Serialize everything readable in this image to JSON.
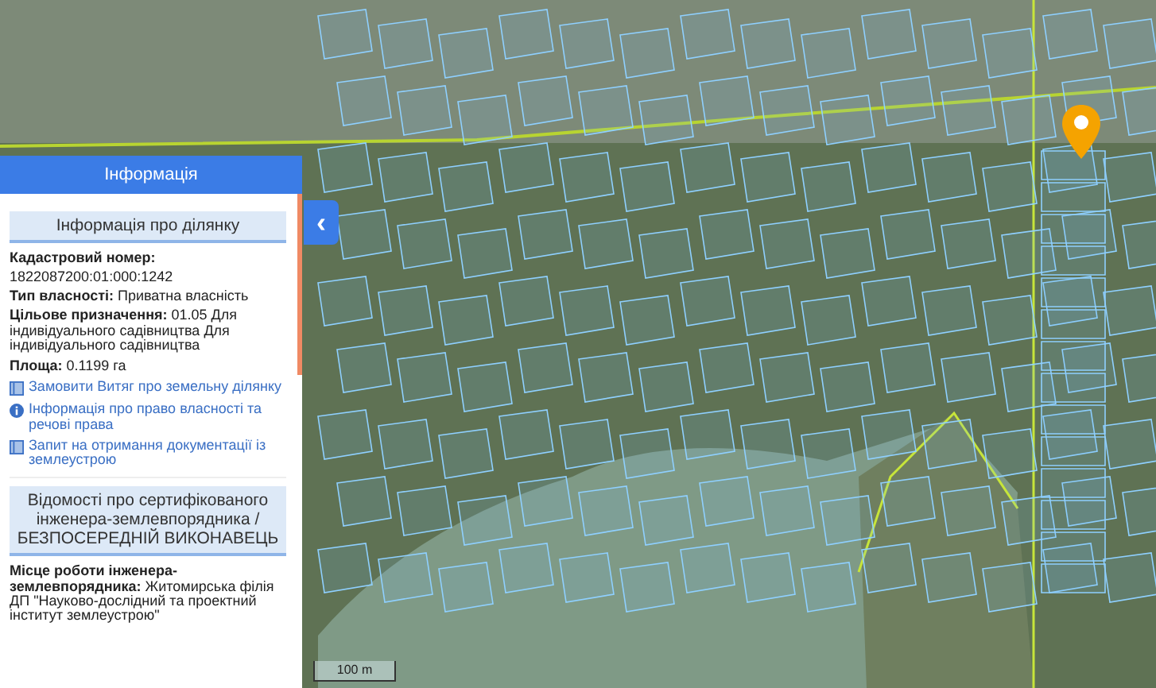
{
  "panel": {
    "title": "Інформація",
    "collapse_button": "‹"
  },
  "parcel_section": {
    "heading": "Інформація про ділянку",
    "fields": [
      {
        "kind": "block",
        "label": "Кадастровий номер:",
        "value": "1822087200:01:000:1242"
      },
      {
        "kind": "inline",
        "label": "Тип власності:",
        "value": "Приватна власність"
      },
      {
        "kind": "inline",
        "label": "Цільове призначення:",
        "value": "01.05 Для індивідуального садівництва Для індивідуального садівництва"
      },
      {
        "kind": "inline",
        "label": "Площа:",
        "value": "0.1199 га"
      }
    ],
    "links": [
      {
        "kind": "document",
        "text": "Замовити Витяг про земельну ділянку"
      },
      {
        "kind": "info",
        "text": "Інформація про право власності та речові права"
      },
      {
        "kind": "document",
        "text": "Запит на отримання документації із землеустрою"
      }
    ]
  },
  "engineer_section": {
    "heading": "Відомості про сертифікованого інженера-землевпорядника / БЕЗПОСЕРЕДНІЙ ВИКОНАВЕЦЬ",
    "fields": [
      {
        "kind": "inline",
        "label": "Місце роботи інженера-землевпорядника:",
        "value": "Житомирська філія ДП \"Науково-дослідний та проектний інститут землеустрою\""
      }
    ]
  },
  "map": {
    "scale": "100 m"
  }
}
